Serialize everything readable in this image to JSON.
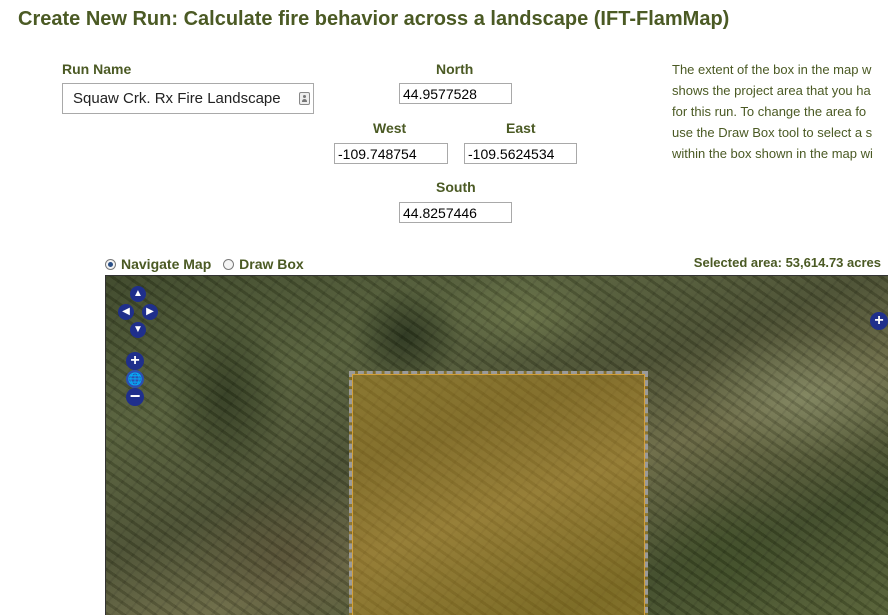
{
  "page": {
    "title": "Create New Run: Calculate fire behavior across a landscape (IFT-FlamMap)"
  },
  "form": {
    "run_name_label": "Run Name",
    "run_name_value": "Squaw Crk. Rx Fire Landscape",
    "north_label": "North",
    "north_value": "44.9577528",
    "west_label": "West",
    "west_value": "-109.748754",
    "east_label": "East",
    "east_value": "-109.5624534",
    "south_label": "South",
    "south_value": "44.8257446"
  },
  "help": {
    "lines": [
      "The extent of the box in the map w",
      "shows the project area that you ha",
      "for this run. To change the area fo",
      "use the Draw Box tool to select a s",
      "within the box shown in the map wi"
    ]
  },
  "map_controls": {
    "navigate_label": "Navigate Map",
    "draw_box_label": "Draw Box",
    "selected_mode": "Navigate Map",
    "selected_area_text": "Selected area: 53,614.73 acres",
    "pan_up_glyph": "▲",
    "pan_down_glyph": "▼",
    "pan_left_glyph": "◀",
    "pan_right_glyph": "▶",
    "zoom_in_glyph": "+",
    "zoom_world_glyph": "🌐",
    "zoom_out_glyph": "−",
    "layer_switcher_glyph": "+"
  },
  "colors": {
    "heading": "#4b5a24",
    "nav_button": "#1f2f8c",
    "selection_fill": "#cd961e"
  },
  "icons": {
    "run_name_field": "contact-card-icon",
    "zoom_world": "globe-icon"
  }
}
